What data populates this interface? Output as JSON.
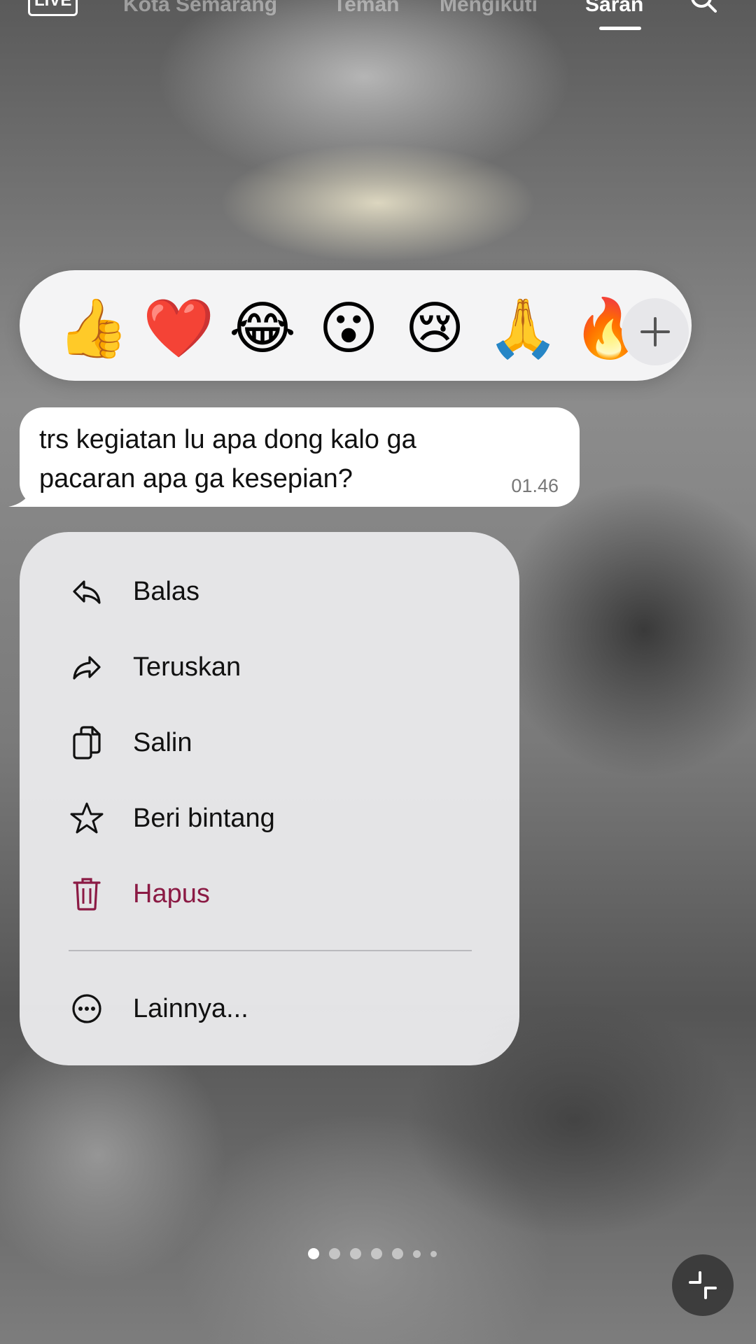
{
  "topnav": {
    "live_label": "LIVE",
    "items": [
      "Kota Semarang",
      "Teman",
      "Mengikuti",
      "Saran"
    ],
    "active_index": 3
  },
  "reactions": {
    "emojis": [
      "👍",
      "❤️",
      "😂",
      "😮",
      "😢",
      "🙏",
      "🔥"
    ],
    "more_icon": "plus-icon"
  },
  "message": {
    "text_line1": "trs kegiatan lu apa dong kalo ga",
    "text_line2": "pacaran apa ga kesepian?",
    "time": "01.46"
  },
  "menu": {
    "items": [
      {
        "label": "Balas",
        "icon": "reply-icon"
      },
      {
        "label": "Teruskan",
        "icon": "forward-icon"
      },
      {
        "label": "Salin",
        "icon": "copy-icon"
      },
      {
        "label": "Beri bintang",
        "icon": "star-icon"
      },
      {
        "label": "Hapus",
        "icon": "trash-icon",
        "color": "#8b1a44"
      },
      {
        "label": "Lainnya...",
        "icon": "more-icon"
      }
    ]
  },
  "pagination": {
    "count": 7,
    "active": 1
  },
  "colors": {
    "danger": "#8b1a44",
    "bubble": "#ffffff",
    "menu_bg": "#e8e8ea"
  }
}
